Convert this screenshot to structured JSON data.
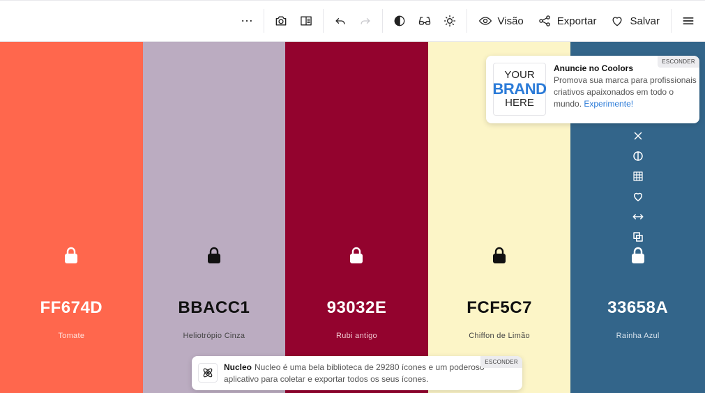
{
  "toolbar": {
    "more_icon": "more-icon",
    "visao_label": "Visão",
    "exportar_label": "Exportar",
    "salvar_label": "Salvar"
  },
  "swatches": [
    {
      "hex": "FF674D",
      "name": "Tomate",
      "color": "#FF674D",
      "text_color": "#ffffff",
      "name_color": "#ffe3dd",
      "locked": true
    },
    {
      "hex": "BBACC1",
      "name": "Heliotrópio Cinza",
      "color": "#BBACC1",
      "text_color": "#111111",
      "name_color": "#444444",
      "locked": true
    },
    {
      "hex": "93032E",
      "name": "Rubi antigo",
      "color": "#93032E",
      "text_color": "#ffffff",
      "name_color": "#f0c7d1",
      "locked": true
    },
    {
      "hex": "FCF5C7",
      "name": "Chiffon de Limão",
      "color": "#FCF5C7",
      "text_color": "#111111",
      "name_color": "#444444",
      "locked": true
    },
    {
      "hex": "33658A",
      "name": "Rainha Azul",
      "color": "#33658A",
      "text_color": "#ffffff",
      "name_color": "#d6e2ec",
      "locked": true
    }
  ],
  "ad": {
    "brand_line1": "YOUR",
    "brand_line2": "BRAND",
    "brand_line3": "HERE",
    "title": "Anuncie no Coolors",
    "text": "Promova sua marca para profissionais criativos apaixonados em todo o mundo.",
    "link": "Experimente!",
    "hide_label": "ESCONDER"
  },
  "notice": {
    "title": "Nucleo",
    "text": "Nucleo é uma bela biblioteca de 29280 ícones e um poderoso aplicativo para coletar e exportar todos os seus ícones.",
    "hide_label": "ESCONDER"
  },
  "colors": {
    "link": "#2b7bd8",
    "toolbar_bg": "#ffffff"
  }
}
